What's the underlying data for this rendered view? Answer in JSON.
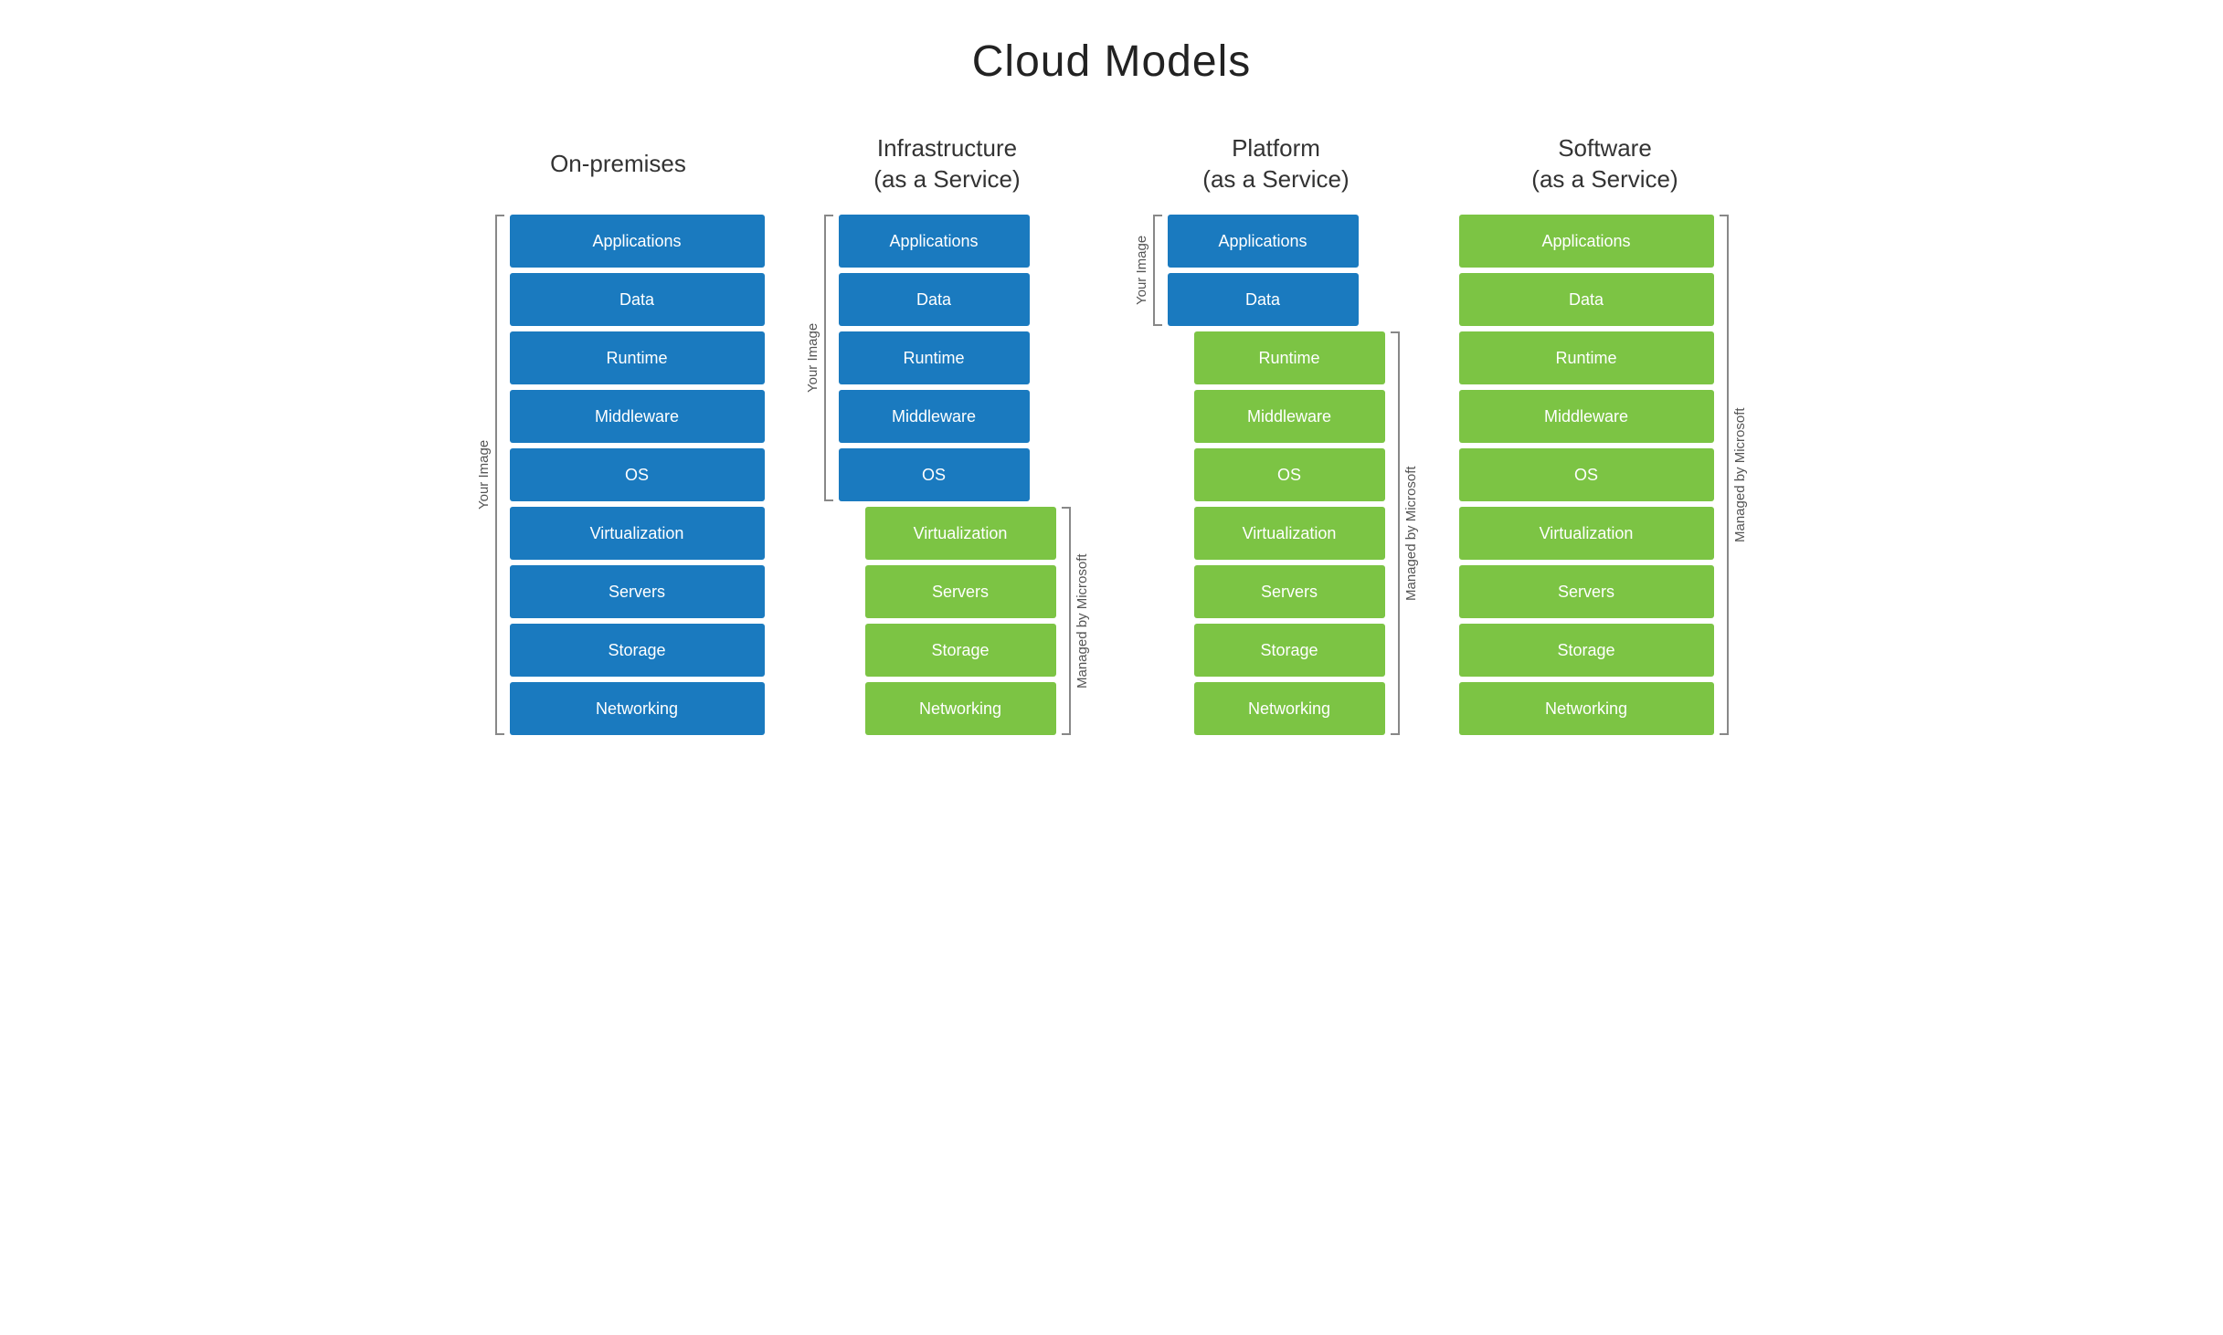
{
  "title": "Cloud Models",
  "columns": [
    {
      "id": "on-premises",
      "title": "On-premises",
      "leftBracket": {
        "label": "Your Image",
        "startIndex": 0,
        "endIndex": 8
      },
      "rightBracket": null,
      "items": [
        {
          "label": "Applications",
          "color": "blue"
        },
        {
          "label": "Data",
          "color": "blue"
        },
        {
          "label": "Runtime",
          "color": "blue"
        },
        {
          "label": "Middleware",
          "color": "blue"
        },
        {
          "label": "OS",
          "color": "blue"
        },
        {
          "label": "Virtualization",
          "color": "blue"
        },
        {
          "label": "Servers",
          "color": "blue"
        },
        {
          "label": "Storage",
          "color": "blue"
        },
        {
          "label": "Networking",
          "color": "blue"
        }
      ]
    },
    {
      "id": "iaas",
      "title": "Infrastructure\n(as a Service)",
      "leftBracketTop": {
        "label": "Your Image",
        "startIndex": 0,
        "endIndex": 4
      },
      "rightBracketBottom": {
        "label": "Managed by Microsoft",
        "startIndex": 5,
        "endIndex": 8
      },
      "items": [
        {
          "label": "Applications",
          "color": "blue"
        },
        {
          "label": "Data",
          "color": "blue"
        },
        {
          "label": "Runtime",
          "color": "blue"
        },
        {
          "label": "Middleware",
          "color": "blue"
        },
        {
          "label": "OS",
          "color": "blue"
        },
        {
          "label": "Virtualization",
          "color": "green"
        },
        {
          "label": "Servers",
          "color": "green"
        },
        {
          "label": "Storage",
          "color": "green"
        },
        {
          "label": "Networking",
          "color": "green"
        }
      ]
    },
    {
      "id": "paas",
      "title": "Platform\n(as a Service)",
      "leftBracketTop": {
        "label": "Your Image",
        "startIndex": 0,
        "endIndex": 1
      },
      "rightBracketBottom": {
        "label": "Managed by Microsoft",
        "startIndex": 2,
        "endIndex": 8
      },
      "items": [
        {
          "label": "Applications",
          "color": "blue"
        },
        {
          "label": "Data",
          "color": "blue"
        },
        {
          "label": "Runtime",
          "color": "green"
        },
        {
          "label": "Middleware",
          "color": "green"
        },
        {
          "label": "OS",
          "color": "green"
        },
        {
          "label": "Virtualization",
          "color": "green"
        },
        {
          "label": "Servers",
          "color": "green"
        },
        {
          "label": "Storage",
          "color": "green"
        },
        {
          "label": "Networking",
          "color": "green"
        }
      ]
    },
    {
      "id": "saas",
      "title": "Software\n(as a Service)",
      "rightBracket": {
        "label": "Managed by Microsoft",
        "startIndex": 0,
        "endIndex": 8
      },
      "items": [
        {
          "label": "Applications",
          "color": "green"
        },
        {
          "label": "Data",
          "color": "green"
        },
        {
          "label": "Runtime",
          "color": "green"
        },
        {
          "label": "Middleware",
          "color": "green"
        },
        {
          "label": "OS",
          "color": "green"
        },
        {
          "label": "Virtualization",
          "color": "green"
        },
        {
          "label": "Servers",
          "color": "green"
        },
        {
          "label": "Storage",
          "color": "green"
        },
        {
          "label": "Networking",
          "color": "green"
        }
      ]
    }
  ]
}
